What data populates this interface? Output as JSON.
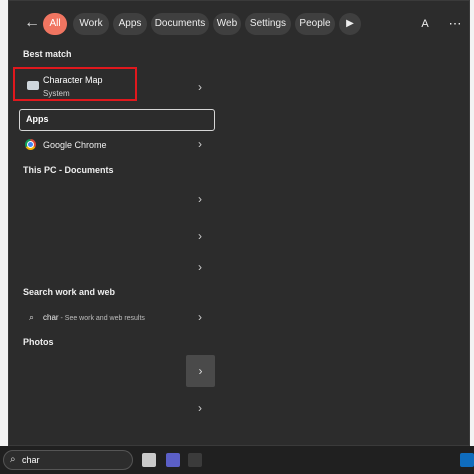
{
  "filter_bar": {
    "back_glyph": "←",
    "chips": [
      "All",
      "Work",
      "Apps",
      "Documents",
      "Web",
      "Settings",
      "People"
    ],
    "active_chip": "All",
    "play_glyph": "▶",
    "avatar_letter": "A",
    "more_glyph": "⋯"
  },
  "sections": {
    "best_match": "Best match",
    "this_pc": "This PC - Documents",
    "search_web": "Search work and web",
    "photos": "Photos"
  },
  "best_match": {
    "title": "Character Map",
    "subtitle": "System"
  },
  "apps": {
    "header": "Apps",
    "items": [
      "Google Chrome"
    ]
  },
  "web_search": {
    "query": "char",
    "hint": " - See work and web results"
  },
  "taskbar": {
    "search_text": "char"
  },
  "colors": {
    "accent": "#f07561",
    "highlight_border": "#e0181d",
    "panel": "#2c2c2c"
  },
  "chevron": "›"
}
